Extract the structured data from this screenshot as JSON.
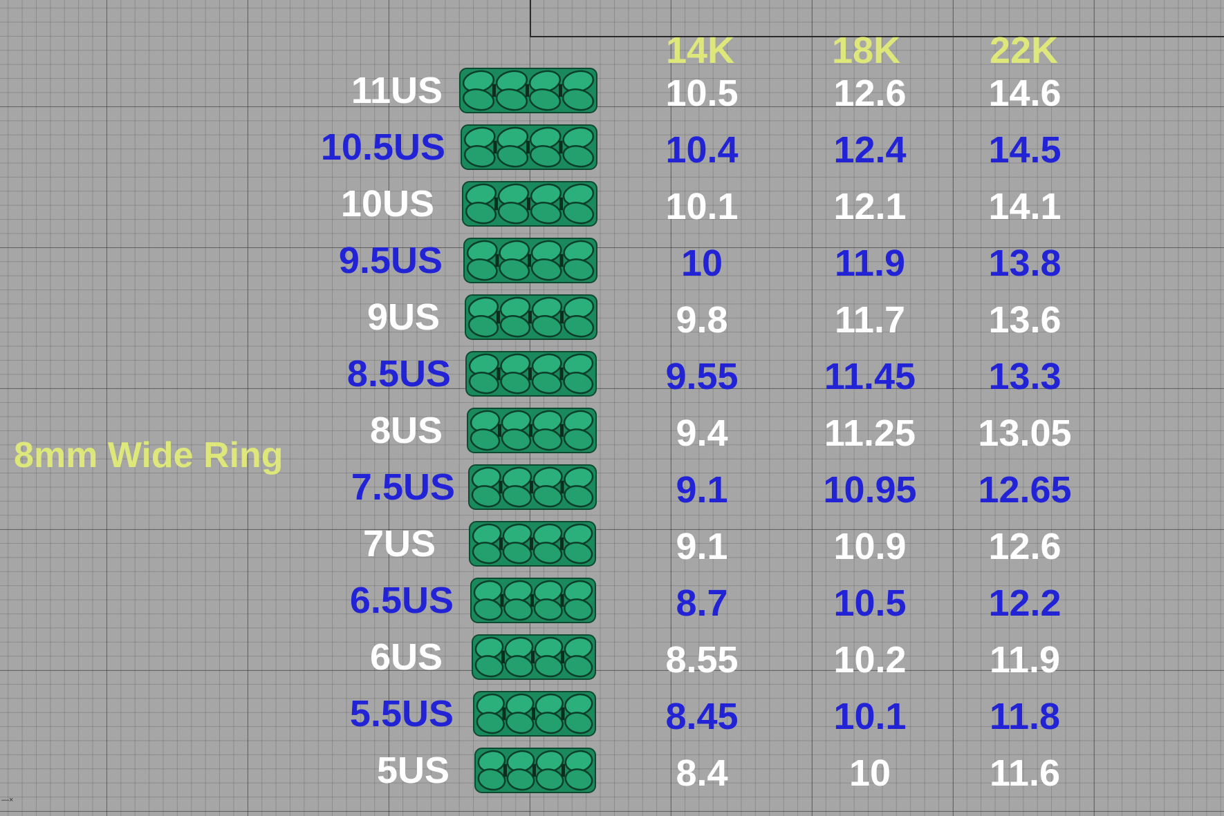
{
  "title": "8mm Wide Ring",
  "headers": [
    "14K",
    "18K",
    "22K"
  ],
  "colors": {
    "header": "#dde77a",
    "row_white": "#ffffff",
    "row_blue": "#2323d6",
    "ring": "#1c8a5e",
    "grid_bg": "#a6a6a6"
  },
  "rows": [
    {
      "size": "11US",
      "k14": "10.5",
      "k18": "12.6",
      "k22": "14.6"
    },
    {
      "size": "10.5US",
      "k14": "10.4",
      "k18": "12.4",
      "k22": "14.5"
    },
    {
      "size": "10US",
      "k14": "10.1",
      "k18": "12.1",
      "k22": "14.1"
    },
    {
      "size": "9.5US",
      "k14": "10",
      "k18": "11.9",
      "k22": "13.8"
    },
    {
      "size": "9US",
      "k14": "9.8",
      "k18": "11.7",
      "k22": "13.6"
    },
    {
      "size": "8.5US",
      "k14": "9.55",
      "k18": "11.45",
      "k22": "13.3"
    },
    {
      "size": "8US",
      "k14": "9.4",
      "k18": "11.25",
      "k22": "13.05"
    },
    {
      "size": "7.5US",
      "k14": "9.1",
      "k18": "10.95",
      "k22": "12.65"
    },
    {
      "size": "7US",
      "k14": "9.1",
      "k18": "10.9",
      "k22": "12.6"
    },
    {
      "size": "6.5US",
      "k14": "8.7",
      "k18": "10.5",
      "k22": "12.2"
    },
    {
      "size": "6US",
      "k14": "8.55",
      "k18": "10.2",
      "k22": "11.9"
    },
    {
      "size": "5.5US",
      "k14": "8.45",
      "k18": "10.1",
      "k22": "11.8"
    },
    {
      "size": "5US",
      "k14": "8.4",
      "k18": "10",
      "k22": "11.6"
    }
  ],
  "icons": {
    "ring": "cuban-link-ring-icon"
  }
}
